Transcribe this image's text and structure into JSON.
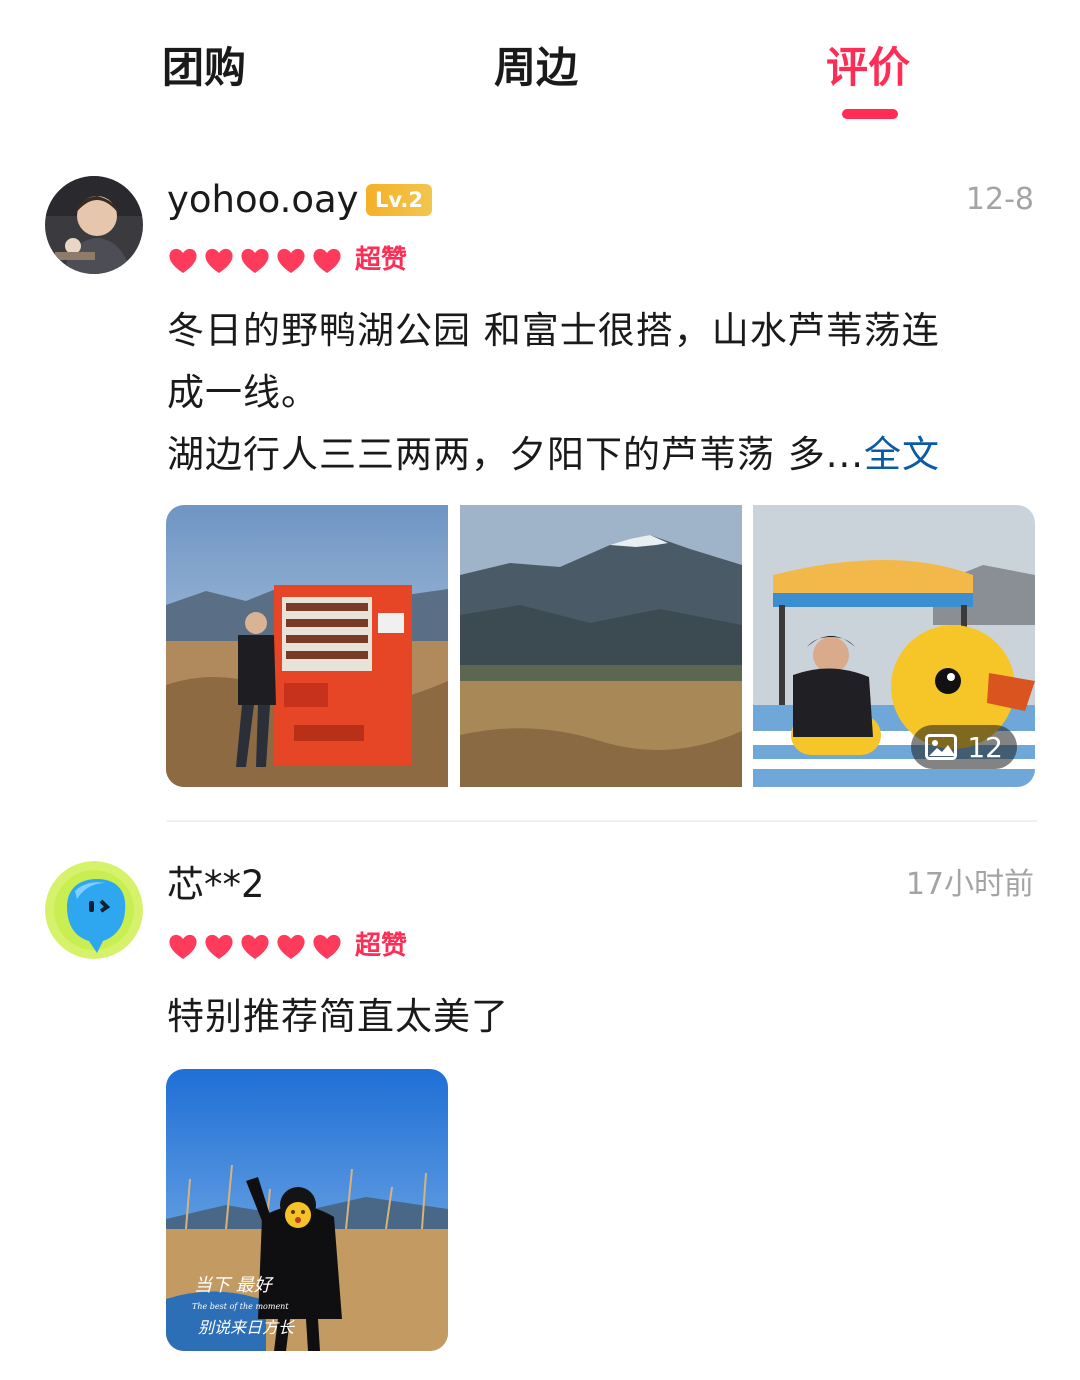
{
  "tabs": [
    {
      "label": "团购",
      "active": false
    },
    {
      "label": "周边",
      "active": false
    },
    {
      "label": "评价",
      "active": true
    }
  ],
  "colors": {
    "accent": "#ff2d55",
    "link": "#0b5aa6",
    "muted": "#a4a4a4",
    "level_badge": "#f5b027"
  },
  "reviews": [
    {
      "username": "yohoo.oay",
      "level": "Lv.2",
      "time": "12-8",
      "rating_hearts": 5,
      "rating_label": "超赞",
      "text_lines": [
        "冬日的野鸭湖公园 和富士很搭，山水芦苇荡连",
        "成一线。",
        "湖边行人三三两两，夕阳下的芦苇荡 多..."
      ],
      "more_label": "全文",
      "image_count": "12"
    },
    {
      "username": "芯**2",
      "time": "17小时前",
      "rating_hearts": 5,
      "rating_label": "超赞",
      "text": "特别推荐简直太美了",
      "photo_caption_lines": [
        "当下 最好",
        "The best of the moment",
        "别说来日方长"
      ]
    }
  ]
}
